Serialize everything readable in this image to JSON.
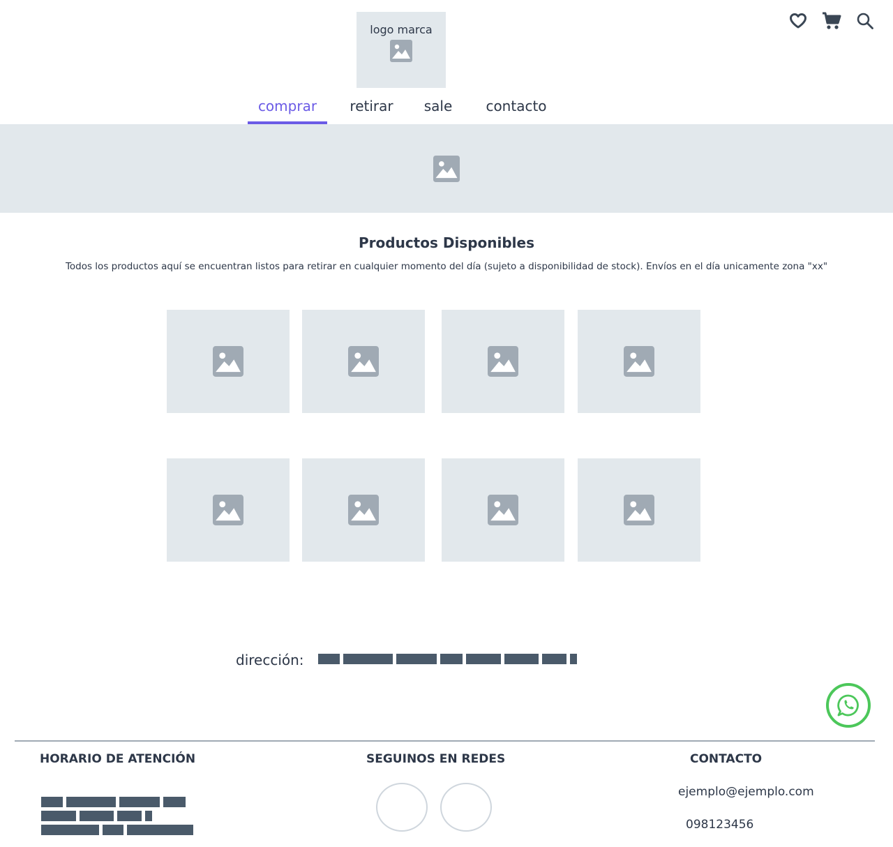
{
  "header": {
    "logo_text": "logo marca",
    "icons": [
      "heart-icon",
      "cart-icon",
      "search-icon"
    ]
  },
  "nav": {
    "tabs": [
      {
        "label": "comprar",
        "active": true
      },
      {
        "label": "retirar",
        "active": false
      },
      {
        "label": "sale",
        "active": false
      },
      {
        "label": "contacto",
        "active": false
      }
    ]
  },
  "main": {
    "title": "Productos Disponibles",
    "description": "Todos los productos aquí se encuentran listos para retirar en cualquier momento del día (sujeto a disponibilidad de stock). Envíos en el día unicamente zona \"xx\"",
    "address_label": "dirección:"
  },
  "footer": {
    "hours_heading": "HORARIO DE ATENCIÓN",
    "social_heading": "SEGUINOS EN REDES",
    "contact_heading": "CONTACTO",
    "email": "ejemplo@ejemplo.com",
    "phone": "098123456"
  },
  "colors": {
    "accent": "#6b5be6",
    "placeholder": "#e2e8ec",
    "icon_gray": "#a0aab4",
    "redacted": "#4a5a6a",
    "whatsapp": "#4cc75a"
  }
}
